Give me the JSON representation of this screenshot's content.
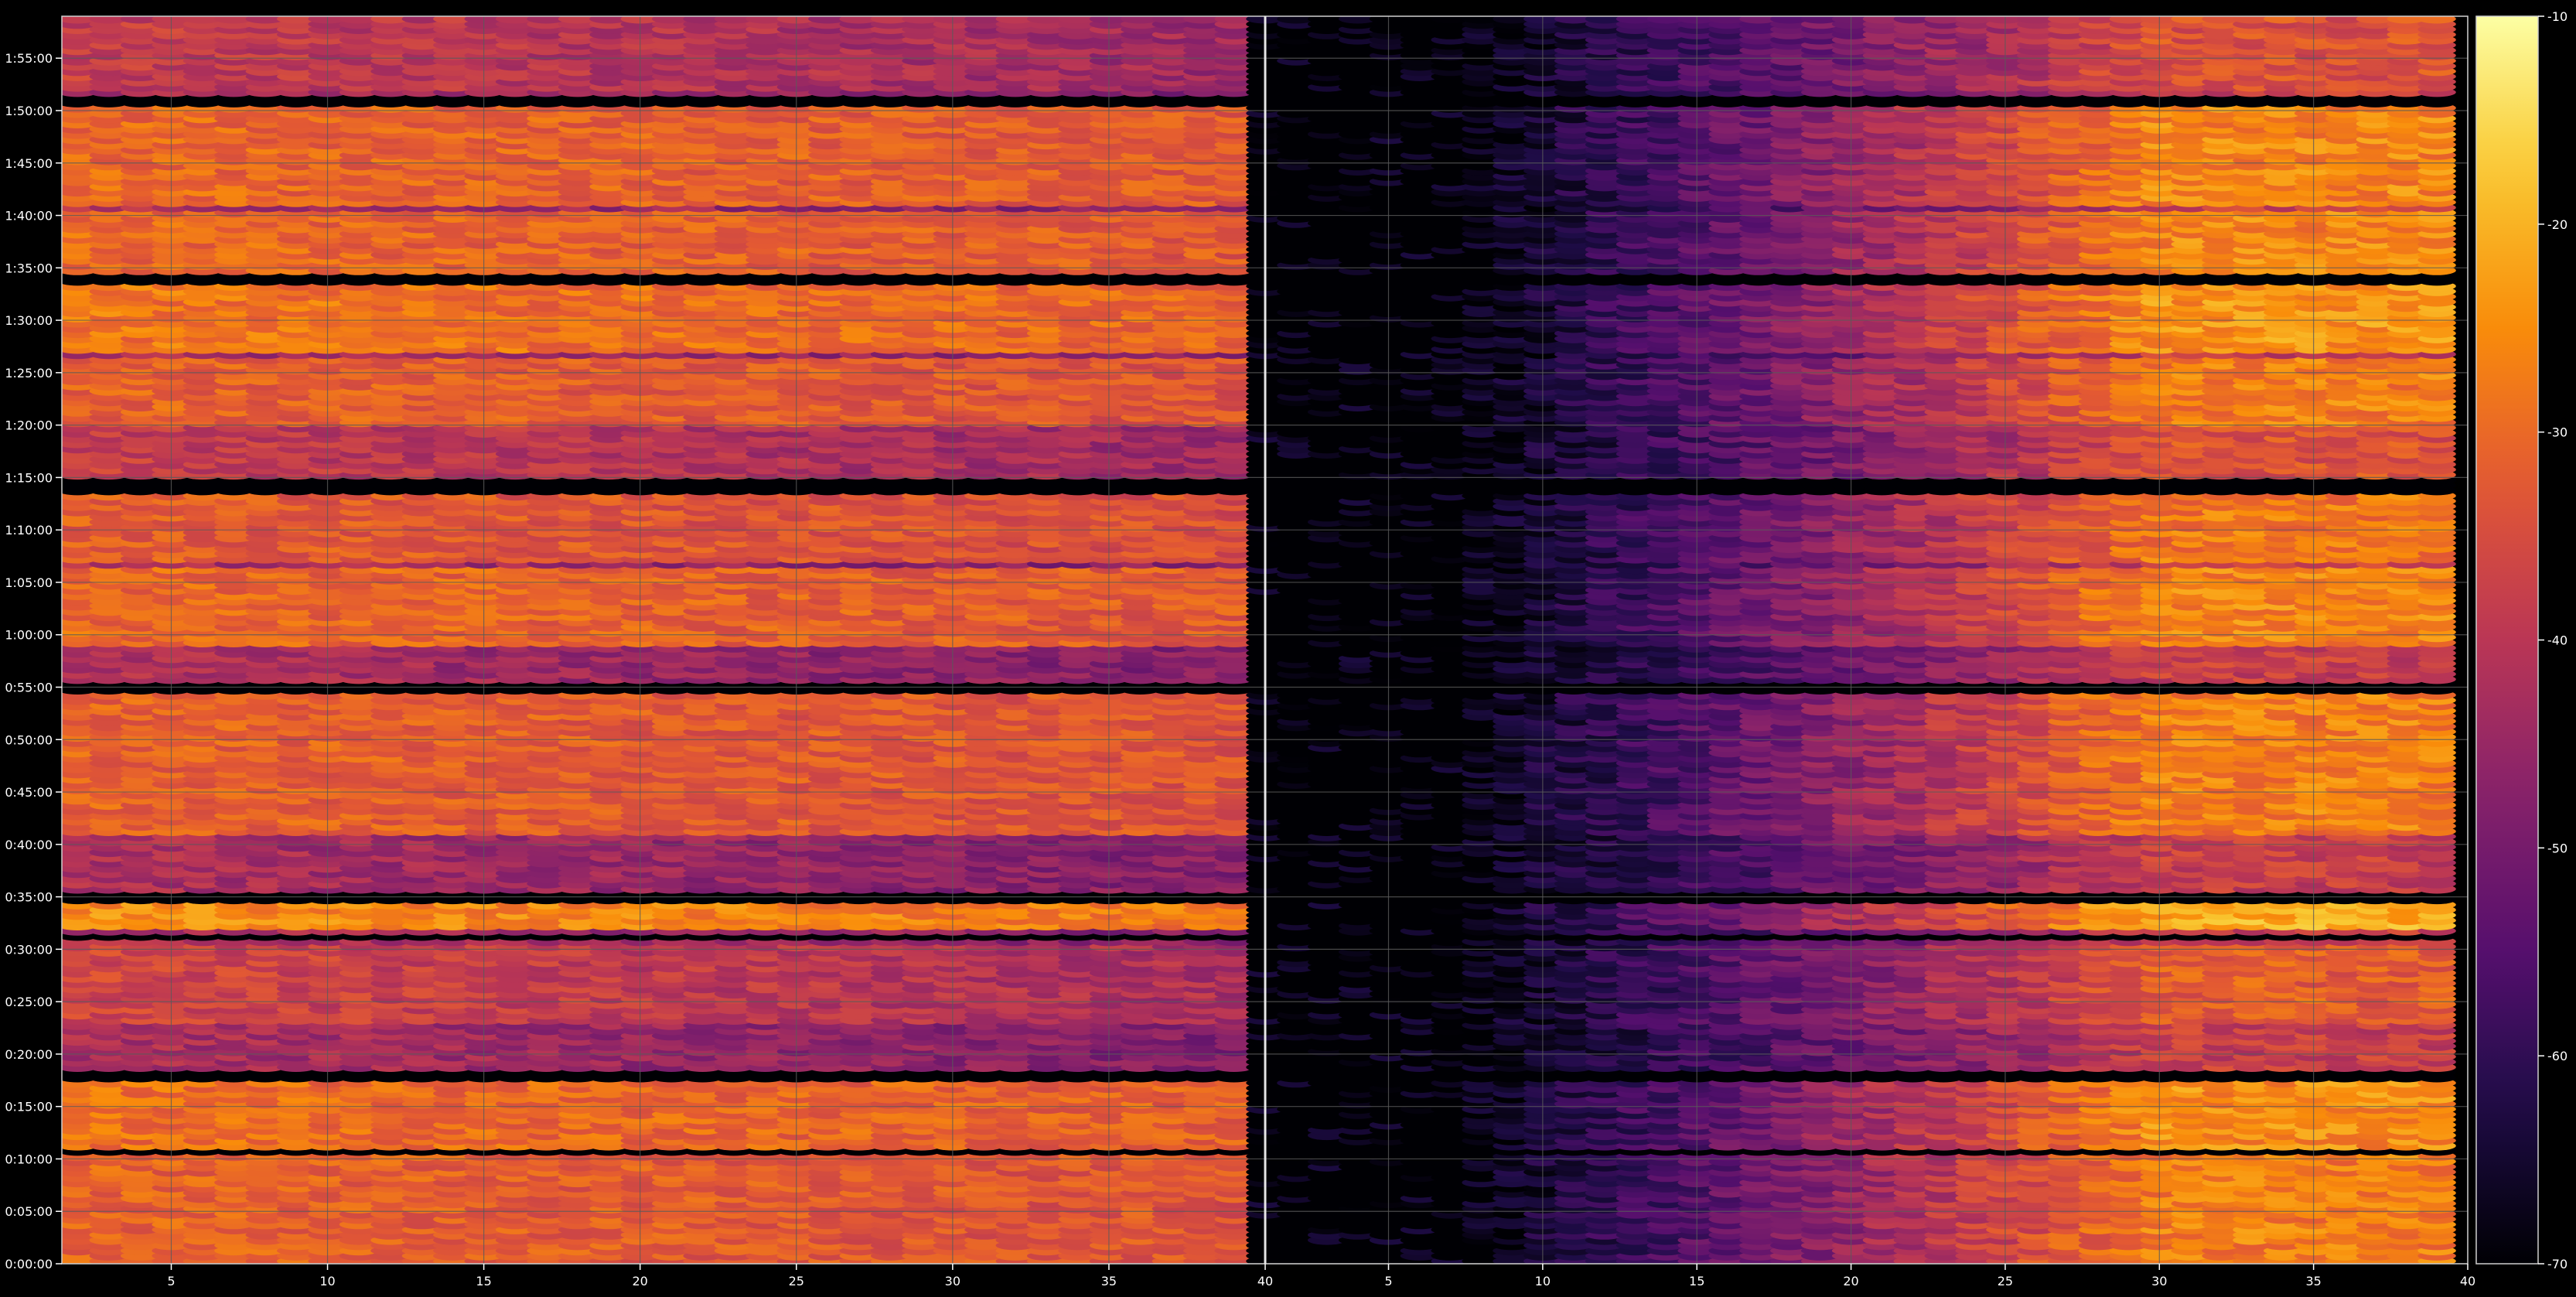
{
  "chart_data": {
    "type": "heatmap",
    "title": "",
    "xlabel": "",
    "ylabel": "",
    "colorscale": "inferno",
    "background": "#000000",
    "grid": true,
    "grid_color": "#5a5a5a",
    "colorbar": {
      "position": "right",
      "range": [
        -70,
        -10
      ],
      "ticks": [
        -10,
        -20,
        -30,
        -40,
        -50,
        -60,
        -70
      ],
      "tick_labels": [
        "-10",
        "-20",
        "-30",
        "-40",
        "-50",
        "-60",
        "-70"
      ]
    },
    "y_axis": {
      "range_minutes": [
        0,
        119
      ],
      "ticks": [
        0,
        5,
        10,
        15,
        20,
        25,
        30,
        35,
        40,
        45,
        50,
        55,
        60,
        65,
        70,
        75,
        80,
        85,
        90,
        95,
        100,
        105,
        110,
        115
      ],
      "tick_labels": [
        "0:00:00",
        "0:05:00",
        "0:10:00",
        "0:15:00",
        "0:20:00",
        "0:25:00",
        "0:30:00",
        "0:35:00",
        "0:40:00",
        "0:45:00",
        "0:50:00",
        "0:55:00",
        "1:00:00",
        "1:05:00",
        "1:10:00",
        "1:15:00",
        "1:20:00",
        "1:25:00",
        "1:30:00",
        "1:35:00",
        "1:40:00",
        "1:45:00",
        "1:50:00",
        "1:55:00"
      ]
    },
    "panels": [
      {
        "name": "",
        "x_range": [
          1.5,
          40
        ],
        "cell_x_range": [
          2,
          39
        ],
        "ticks": [
          5,
          10,
          15,
          20,
          25,
          30,
          35,
          40
        ],
        "tick_labels": [
          "5",
          "10",
          "15",
          "20",
          "25",
          "30",
          "35",
          "40"
        ],
        "level_db": -33,
        "level_slope_per_col": -0.12
      },
      {
        "name": "",
        "x_range": [
          1.0,
          40
        ],
        "cell_x_range": [
          1,
          39
        ],
        "ticks": [
          5,
          10,
          15,
          20,
          25,
          30,
          35,
          40
        ],
        "tick_labels": [
          "5",
          "10",
          "15",
          "20",
          "25",
          "30",
          "35",
          "40"
        ],
        "level_db": -80,
        "level_slope_per_col": 1.0
      }
    ],
    "activity_bands_minutes": [
      {
        "from": 0,
        "to": 10,
        "level_db": -31
      },
      {
        "from": 11,
        "to": 17,
        "level_db": -29
      },
      {
        "from": 23,
        "to": 30,
        "level_db": -36
      },
      {
        "from": 32,
        "to": 34,
        "level_db": -25
      },
      {
        "from": 41,
        "to": 54,
        "level_db": -31
      },
      {
        "from": 59,
        "to": 66,
        "level_db": -30
      },
      {
        "from": 67,
        "to": 73,
        "level_db": -32
      },
      {
        "from": 75,
        "to": 80,
        "level_db": -38
      },
      {
        "from": 80,
        "to": 86,
        "level_db": -31
      },
      {
        "from": 87,
        "to": 93,
        "level_db": -28
      },
      {
        "from": 94,
        "to": 100,
        "level_db": -30
      },
      {
        "from": 101,
        "to": 110,
        "level_db": -30
      },
      {
        "from": 112,
        "to": 119,
        "level_db": -38
      }
    ],
    "quiet_gaps_minutes": [
      {
        "from": 10.4,
        "to": 10.9
      },
      {
        "from": 17.2,
        "to": 18.0
      },
      {
        "from": 30.6,
        "to": 31.2
      },
      {
        "from": 34.2,
        "to": 35.0
      },
      {
        "from": 54.4,
        "to": 55.0
      },
      {
        "from": 73.5,
        "to": 74.6
      },
      {
        "from": 93.3,
        "to": 94.0
      },
      {
        "from": 110.4,
        "to": 111.0
      }
    ]
  }
}
